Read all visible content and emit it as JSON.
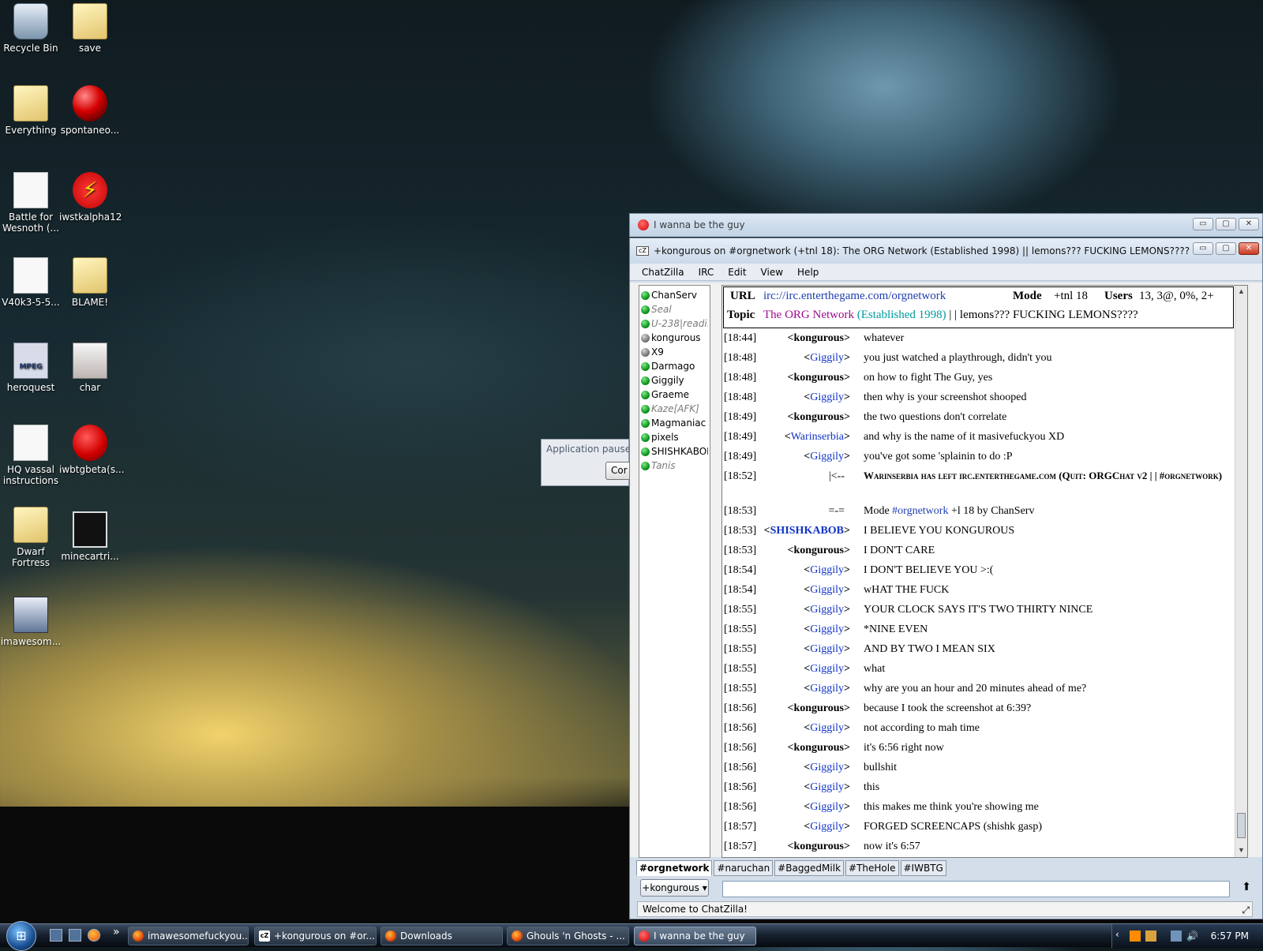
{
  "desktop": {
    "icons": [
      {
        "label": "Recycle Bin"
      },
      {
        "label": "save"
      },
      {
        "label": "Everything"
      },
      {
        "label": "spontaneo..."
      },
      {
        "label": "Battle for Wesnoth (..."
      },
      {
        "label": "iwstkalpha12"
      },
      {
        "label": "V40k3-5-5..."
      },
      {
        "label": "BLAME!"
      },
      {
        "label": "heroquest"
      },
      {
        "label": "char"
      },
      {
        "label": "HQ vassal instructions"
      },
      {
        "label": "iwbtgbeta(s..."
      },
      {
        "label": "Dwarf Fortress"
      },
      {
        "label": "minecartri..."
      },
      {
        "label": "imawesom..."
      }
    ],
    "mpeg_badge": "MPEG"
  },
  "iwbtg_window": {
    "title": "I wanna be the guy"
  },
  "paused_dialog": {
    "title": "Application paused",
    "button": "Cor"
  },
  "chatzilla": {
    "title": "+kongurous on #orgnetwork (+tnl 18): The ORG Network (Established 1998) ||  lemons??? FUCKING LEMONS????",
    "logo": "cZ",
    "menus": [
      "ChatZilla",
      "IRC",
      "Edit",
      "View",
      "Help"
    ],
    "window_buttons": {
      "minimize": "▭",
      "maximize": "▢",
      "close": "✕"
    },
    "users": [
      {
        "name": "ChanServ",
        "status": "op"
      },
      {
        "name": "Seal",
        "status": "away"
      },
      {
        "name": "U-238|readi...",
        "status": "away"
      },
      {
        "name": "kongurous",
        "status": "normal"
      },
      {
        "name": "X9",
        "status": "normal"
      },
      {
        "name": "Darmago",
        "status": "op"
      },
      {
        "name": "Giggily",
        "status": "op"
      },
      {
        "name": "Graeme",
        "status": "op"
      },
      {
        "name": "Kaze[AFK]",
        "status": "away"
      },
      {
        "name": "Magmaniac",
        "status": "op"
      },
      {
        "name": "pixels",
        "status": "op"
      },
      {
        "name": "SHISHKABOB",
        "status": "op"
      },
      {
        "name": "Tanis",
        "status": "away"
      }
    ],
    "header": {
      "url_label": "URL",
      "url": "irc://irc.enterthegame.com/orgnetwork",
      "mode_label": "Mode",
      "mode": "+tnl 18",
      "users_label": "Users",
      "users": "13, 3@, 0%, 2+",
      "topic_label": "Topic",
      "topic_part1": "The ORG Network",
      "topic_part2": "(Established 1998)",
      "topic_part3": "| | lemons??? FUCKING LEMONS????"
    },
    "messages": [
      {
        "time": "[18:44]",
        "nick": "kongurous",
        "self": true,
        "text": "whatever"
      },
      {
        "time": "[18:48]",
        "nick": "Giggily",
        "self": false,
        "text": "you just watched a playthrough, didn't you"
      },
      {
        "time": "[18:48]",
        "nick": "kongurous",
        "self": true,
        "text": "on how to fight The Guy, yes"
      },
      {
        "time": "[18:48]",
        "nick": "Giggily",
        "self": false,
        "text": "then why is your screenshot shooped"
      },
      {
        "time": "[18:49]",
        "nick": "kongurous",
        "self": true,
        "text": "the two questions don't correlate"
      },
      {
        "time": "[18:49]",
        "nick": "Warinserbia",
        "self": false,
        "text": "and why is the name of it masivefuckyou XD"
      },
      {
        "time": "[18:49]",
        "nick": "Giggily",
        "self": false,
        "text": "you've got some 'splainin to do :P"
      },
      {
        "time": "[18:52]",
        "type": "quit",
        "arrow": "|<--",
        "text": "Warinserbia has left irc.enterthegame.com (Quit: ORGChat v2 | | #orgnetwork)"
      },
      {
        "time": "[18:53]",
        "type": "mode",
        "arrow": "=-=",
        "text_pre": "Mode",
        "channel": "#orgnetwork",
        "text_post": "+l 18 by ChanServ"
      },
      {
        "time": "[18:53]",
        "nick": "SHISHKABOB",
        "self": false,
        "bold": true,
        "text": "I BELIEVE YOU KONGUROUS"
      },
      {
        "time": "[18:53]",
        "nick": "kongurous",
        "self": true,
        "text": "I DON'T CARE"
      },
      {
        "time": "[18:54]",
        "nick": "Giggily",
        "self": false,
        "text": "I DON'T BELIEVE YOU >:("
      },
      {
        "time": "[18:54]",
        "nick": "Giggily",
        "self": false,
        "text": "wHAT THE FUCK"
      },
      {
        "time": "[18:55]",
        "nick": "Giggily",
        "self": false,
        "text": "YOUR CLOCK SAYS IT'S TWO THIRTY NINCE"
      },
      {
        "time": "[18:55]",
        "nick": "Giggily",
        "self": false,
        "text": "*NINE EVEN"
      },
      {
        "time": "[18:55]",
        "nick": "Giggily",
        "self": false,
        "text": "AND BY TWO I MEAN SIX"
      },
      {
        "time": "[18:55]",
        "nick": "Giggily",
        "self": false,
        "text": "what"
      },
      {
        "time": "[18:55]",
        "nick": "Giggily",
        "self": false,
        "text": "why are you an hour and 20 minutes ahead of me?"
      },
      {
        "time": "[18:56]",
        "nick": "kongurous",
        "self": true,
        "text": "because I took the screenshot at 6:39?"
      },
      {
        "time": "[18:56]",
        "nick": "Giggily",
        "self": false,
        "text": "not according to mah time"
      },
      {
        "time": "[18:56]",
        "nick": "kongurous",
        "self": true,
        "text": "it's 6:56 right now"
      },
      {
        "time": "[18:56]",
        "nick": "Giggily",
        "self": false,
        "text": "bullshit"
      },
      {
        "time": "[18:56]",
        "nick": "Giggily",
        "self": false,
        "text": "this"
      },
      {
        "time": "[18:56]",
        "nick": "Giggily",
        "self": false,
        "text": "this makes me think you're showing me"
      },
      {
        "time": "[18:57]",
        "nick": "Giggily",
        "self": false,
        "text": "FORGED SCREENCAPS (shishk gasp)"
      },
      {
        "time": "[18:57]",
        "nick": "kongurous",
        "self": true,
        "text": "now it's 6:57"
      }
    ],
    "tabs": [
      "#orgnetwork",
      "#naruchan",
      "#BaggedMilk",
      "#TheHole",
      "#IWBTG"
    ],
    "active_tab": 0,
    "nick_button": "+kongurous ▾",
    "input_value": "",
    "status_text": "Welcome to ChatZilla!"
  },
  "taskbar": {
    "more": "»",
    "tasks": [
      {
        "label": "imawesomefuckyou...",
        "icon": "firefox-icon"
      },
      {
        "label": "+kongurous on #or...",
        "icon": "chatzilla-icon"
      },
      {
        "label": "Downloads",
        "icon": "firefox-icon"
      },
      {
        "label": "Ghouls 'n Ghosts - ...",
        "icon": "firefox-icon"
      },
      {
        "label": "I wanna be the guy",
        "icon": "apple-icon"
      }
    ],
    "clock": "6:57 PM"
  }
}
